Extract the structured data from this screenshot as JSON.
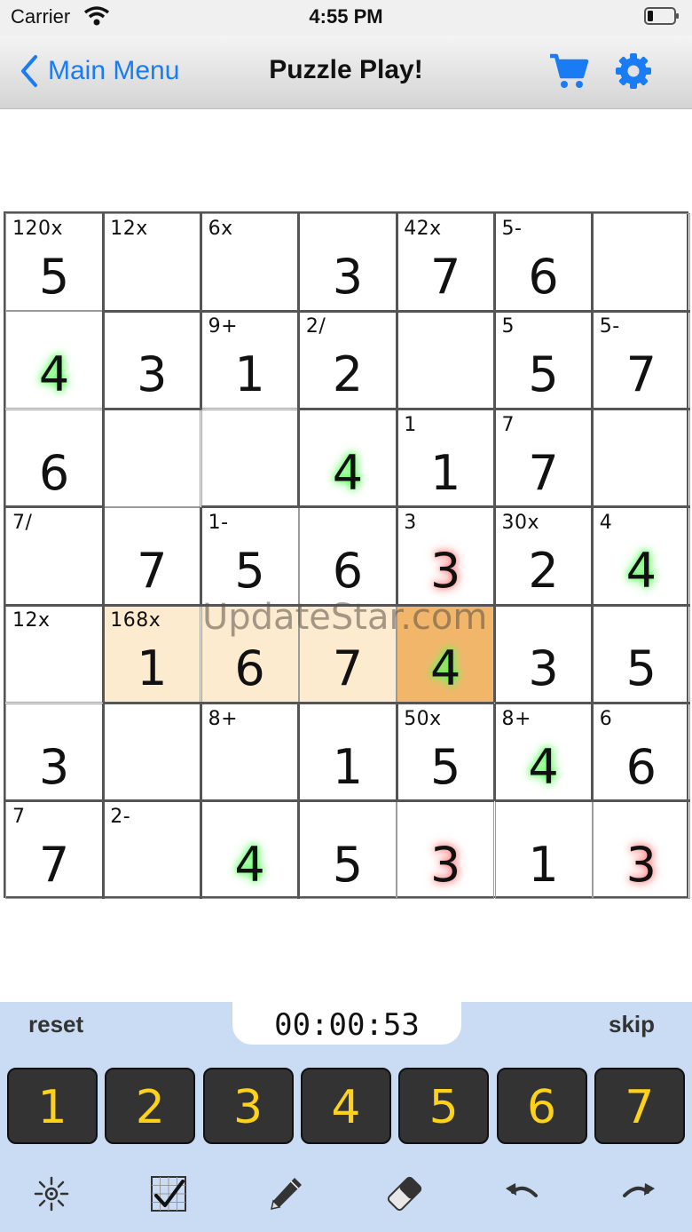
{
  "status_bar": {
    "carrier": "Carrier",
    "time": "4:55 PM"
  },
  "nav": {
    "back_label": "Main Menu",
    "title": "Puzzle Play!",
    "accent_color": "#1a7cf5"
  },
  "grid": {
    "size": 7,
    "cells": [
      [
        {
          "cage": "120x",
          "value": "5",
          "glow": ""
        },
        {
          "cage": "12x",
          "value": "",
          "glow": ""
        },
        {
          "cage": "6x",
          "value": "",
          "glow": ""
        },
        {
          "cage": "",
          "value": "3",
          "glow": ""
        },
        {
          "cage": "42x",
          "value": "7",
          "glow": ""
        },
        {
          "cage": "5-",
          "value": "6",
          "glow": ""
        },
        {
          "cage": "",
          "value": "",
          "glow": ""
        }
      ],
      [
        {
          "cage": "",
          "value": "4",
          "glow": "green"
        },
        {
          "cage": "",
          "value": "3",
          "glow": ""
        },
        {
          "cage": "9+",
          "value": "1",
          "glow": ""
        },
        {
          "cage": "2/",
          "value": "2",
          "glow": ""
        },
        {
          "cage": "",
          "value": "",
          "glow": ""
        },
        {
          "cage": "5",
          "value": "5",
          "glow": ""
        },
        {
          "cage": "5-",
          "value": "7",
          "glow": ""
        }
      ],
      [
        {
          "cage": "",
          "value": "6",
          "glow": ""
        },
        {
          "cage": "",
          "value": "",
          "glow": ""
        },
        {
          "cage": "",
          "value": "",
          "glow": ""
        },
        {
          "cage": "",
          "value": "4",
          "glow": "green"
        },
        {
          "cage": "1",
          "value": "1",
          "glow": ""
        },
        {
          "cage": "7",
          "value": "7",
          "glow": ""
        },
        {
          "cage": "",
          "value": "",
          "glow": ""
        }
      ],
      [
        {
          "cage": "7/",
          "value": "",
          "glow": ""
        },
        {
          "cage": "",
          "value": "7",
          "glow": ""
        },
        {
          "cage": "1-",
          "value": "5",
          "glow": ""
        },
        {
          "cage": "",
          "value": "6",
          "glow": ""
        },
        {
          "cage": "3",
          "value": "3",
          "glow": "red"
        },
        {
          "cage": "30x",
          "value": "2",
          "glow": ""
        },
        {
          "cage": "4",
          "value": "4",
          "glow": "green"
        }
      ],
      [
        {
          "cage": "12x",
          "value": "",
          "glow": ""
        },
        {
          "cage": "168x",
          "value": "1",
          "glow": "",
          "hl": "light"
        },
        {
          "cage": "",
          "value": "6",
          "glow": "",
          "hl": "light"
        },
        {
          "cage": "",
          "value": "7",
          "glow": "",
          "hl": "light"
        },
        {
          "cage": "",
          "value": "4",
          "glow": "green",
          "hl": "dark"
        },
        {
          "cage": "",
          "value": "3",
          "glow": ""
        },
        {
          "cage": "",
          "value": "5",
          "glow": ""
        }
      ],
      [
        {
          "cage": "",
          "value": "3",
          "glow": ""
        },
        {
          "cage": "",
          "value": "",
          "glow": ""
        },
        {
          "cage": "8+",
          "value": "",
          "glow": ""
        },
        {
          "cage": "",
          "value": "1",
          "glow": ""
        },
        {
          "cage": "50x",
          "value": "5",
          "glow": ""
        },
        {
          "cage": "8+",
          "value": "4",
          "glow": "green"
        },
        {
          "cage": "6",
          "value": "6",
          "glow": ""
        }
      ],
      [
        {
          "cage": "7",
          "value": "7",
          "glow": ""
        },
        {
          "cage": "2-",
          "value": "",
          "glow": ""
        },
        {
          "cage": "",
          "value": "4",
          "glow": "green"
        },
        {
          "cage": "",
          "value": "5",
          "glow": ""
        },
        {
          "cage": "",
          "value": "3",
          "glow": "red"
        },
        {
          "cage": "",
          "value": "1",
          "glow": ""
        },
        {
          "cage": "",
          "value": "3",
          "glow": "red"
        }
      ]
    ]
  },
  "watermark": "UpdateStar.com",
  "controls": {
    "reset_label": "reset",
    "timer": "00:00:53",
    "skip_label": "skip",
    "numpad": [
      "1",
      "2",
      "3",
      "4",
      "5",
      "6",
      "7"
    ],
    "numpad_text_color": "#ffd21a",
    "tools": [
      "hint-icon",
      "check-grid-icon",
      "pencil-icon",
      "eraser-icon",
      "undo-icon",
      "redo-icon"
    ]
  }
}
